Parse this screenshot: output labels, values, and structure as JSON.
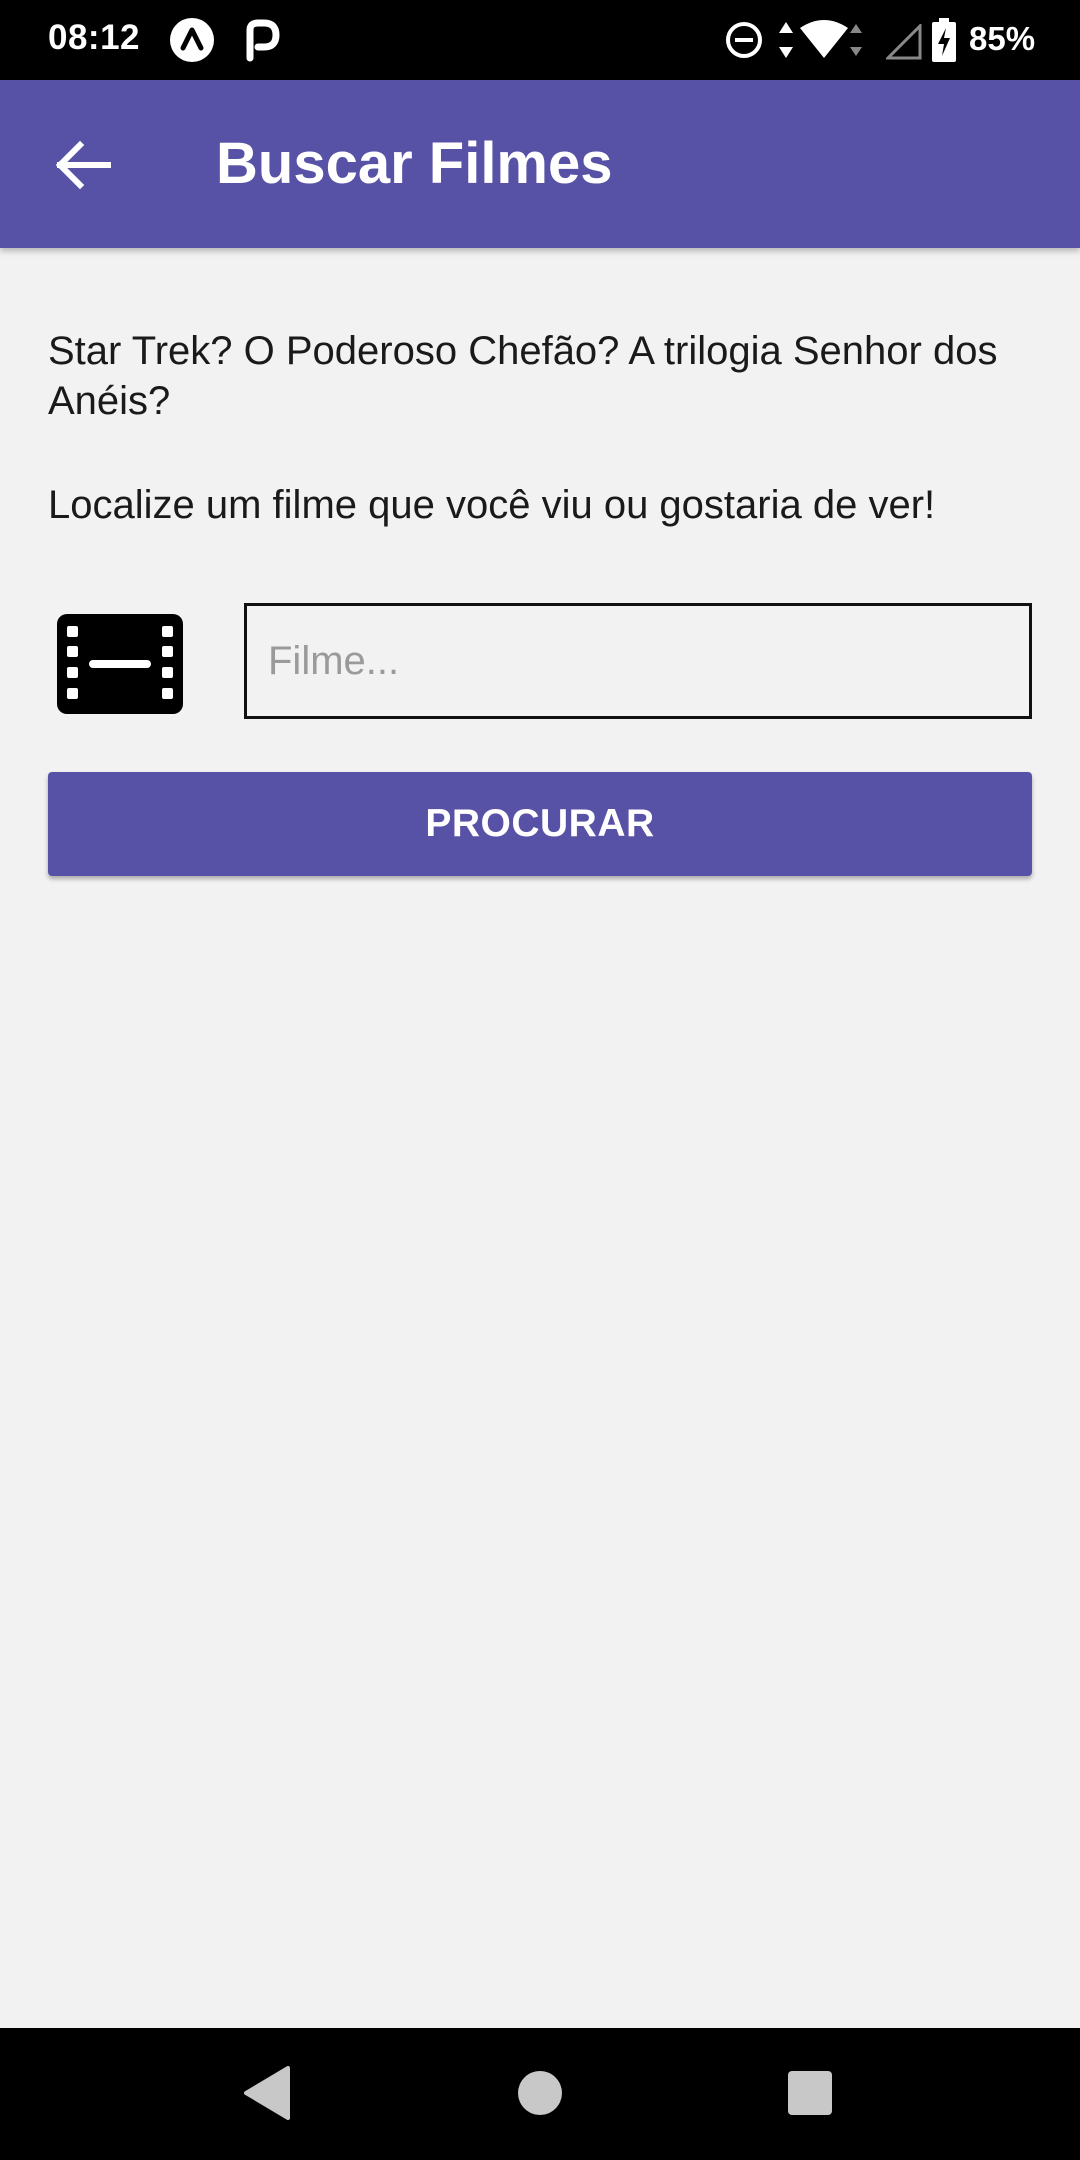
{
  "status_bar": {
    "time": "08:12",
    "battery_percent": "85%",
    "icons": [
      "expo-a-icon",
      "p-notification-icon",
      "do-not-disturb-icon",
      "data-arrows-icon",
      "wifi-icon",
      "cell-signal-icon",
      "battery-charging-icon"
    ]
  },
  "app_bar": {
    "title": "Buscar Filmes",
    "back_icon": "arrow-left-icon"
  },
  "content": {
    "intro_line_1": "Star Trek? O Poderoso Chefão? A trilogia Senhor dos Anéis?",
    "intro_line_2": "Localize um filme que você viu ou gostaria de ver!",
    "film_icon": "movie-film-icon",
    "search_field": {
      "value": "",
      "placeholder": "Filme..."
    },
    "search_button_label": "PROCURAR"
  },
  "colors": {
    "primary": "#5852a6",
    "background": "#f2f2f2",
    "text": "#1a1a1a"
  },
  "nav_bar": {
    "icons": [
      "nav-back-icon",
      "nav-home-icon",
      "nav-recents-icon"
    ]
  }
}
